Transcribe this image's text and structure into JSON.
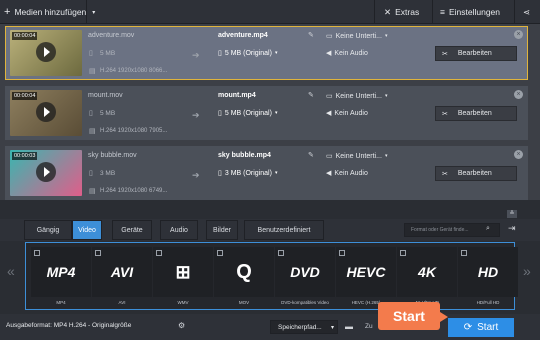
{
  "toolbar": {
    "add_media": "Medien hinzufügen",
    "extras": "Extras",
    "settings": "Einstellungen"
  },
  "files": [
    {
      "duration": "00:00:04",
      "source_name": "adventure.mov",
      "source_size": "5 MB",
      "source_codec": "H.264 1920x1080 8066...",
      "output_name": "adventure.mp4",
      "output_size": "5 MB (Original)",
      "subtitle": "Keine Unterti...",
      "audio": "Kein Audio",
      "edit_label": "Bearbeiten",
      "thumb_colors": [
        "#b9b07a",
        "#6d6a3f"
      ]
    },
    {
      "duration": "00:00:04",
      "source_name": "mount.mov",
      "source_size": "5 MB",
      "source_codec": "H.264 1920x1080 7905...",
      "output_name": "mount.mp4",
      "output_size": "5 MB (Original)",
      "subtitle": "Keine Unterti...",
      "audio": "Kein Audio",
      "edit_label": "Bearbeiten",
      "thumb_colors": [
        "#8d7e5e",
        "#5a4d36"
      ]
    },
    {
      "duration": "00:00:03",
      "source_name": "sky bubble.mov",
      "source_size": "3 MB",
      "source_codec": "H.264 1920x1080 6749...",
      "output_name": "sky bubble.mp4",
      "output_size": "3 MB (Original)",
      "subtitle": "Keine Unterti...",
      "audio": "Kein Audio",
      "edit_label": "Bearbeiten",
      "thumb_colors": [
        "#39b6b0",
        "#e05e8a"
      ]
    }
  ],
  "tabs": [
    "Gängig",
    "Video",
    "Geräte",
    "Audio",
    "Bilder",
    "Benutzerdefiniert"
  ],
  "active_tab": "Video",
  "search_placeholder": "Format oder Gerät finde...",
  "formats": [
    {
      "logo": "MP4",
      "label": "MP4"
    },
    {
      "logo": "AVI",
      "label": "AVI"
    },
    {
      "logo": "WMV",
      "label": "WMV"
    },
    {
      "logo": "MOV",
      "label": "MOV"
    },
    {
      "logo": "DVD",
      "label": "DVD-kompatibles Video"
    },
    {
      "logo": "HEVC",
      "label": "HEVC (H.265)"
    },
    {
      "logo": "4K",
      "label": "4K Ultra HD"
    },
    {
      "logo": "HD",
      "label": "HD/Full HD"
    }
  ],
  "bottom": {
    "output_format": "Ausgabeformat: MP4 H.264 - Originalgröße",
    "save_path": "Speicherpfad...",
    "zu": "Zu",
    "start": "Start"
  },
  "tooltip": "Start",
  "colors": {
    "accent": "#2d8ee6",
    "tooltip": "#f37b4c",
    "selected_border": "#e0b43c"
  }
}
